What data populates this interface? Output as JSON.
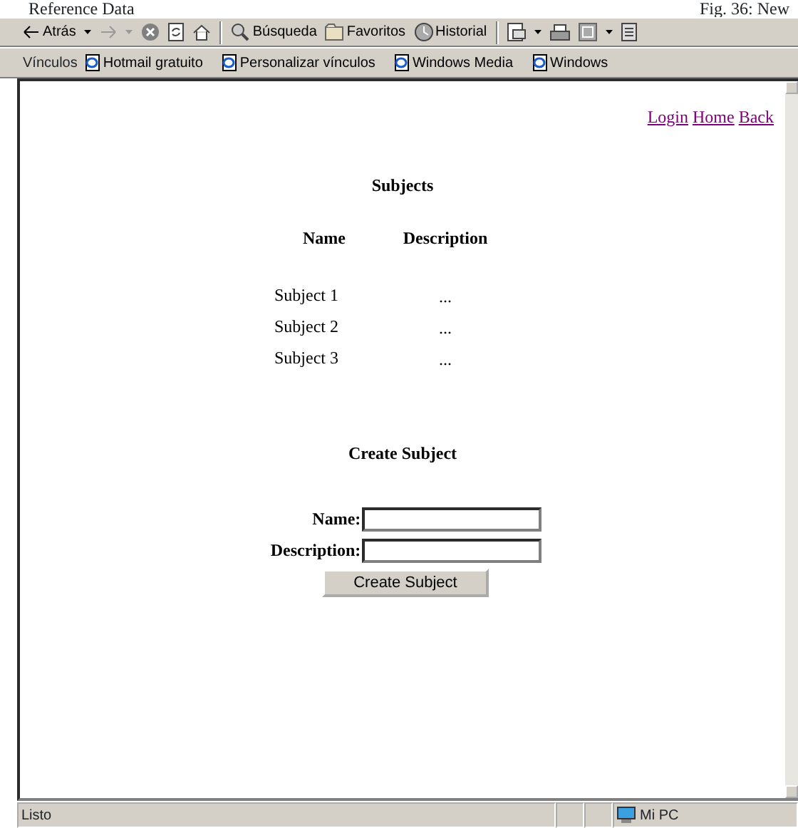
{
  "document_header": {
    "left": "Reference Data",
    "right": "Fig. 36: New"
  },
  "toolbar": {
    "back": {
      "label": "Atrás"
    },
    "forward": {
      "disabled": true
    },
    "search": {
      "label": "Búsqueda"
    },
    "favorites": {
      "label": "Favoritos"
    },
    "history": {
      "label": "Historial"
    }
  },
  "links_bar": {
    "label": "Vínculos",
    "links": [
      "Hotmail gratuito",
      "Personalizar vínculos",
      "Windows Media",
      "Windows"
    ]
  },
  "page": {
    "nav_links": [
      "Login",
      "Home",
      "Back"
    ],
    "title": "Subjects",
    "table": {
      "columns": [
        "Name",
        "Description"
      ],
      "rows": [
        {
          "name": "Subject 1",
          "description": "..."
        },
        {
          "name": "Subject 2",
          "description": "..."
        },
        {
          "name": "Subject 3",
          "description": "..."
        }
      ]
    },
    "form": {
      "title": "Create Subject",
      "fields": [
        {
          "label": "Name:"
        },
        {
          "label": "Description:"
        }
      ],
      "submit": "Create Subject"
    }
  },
  "status_bar": {
    "text": "Listo",
    "zone": "Mi PC"
  }
}
